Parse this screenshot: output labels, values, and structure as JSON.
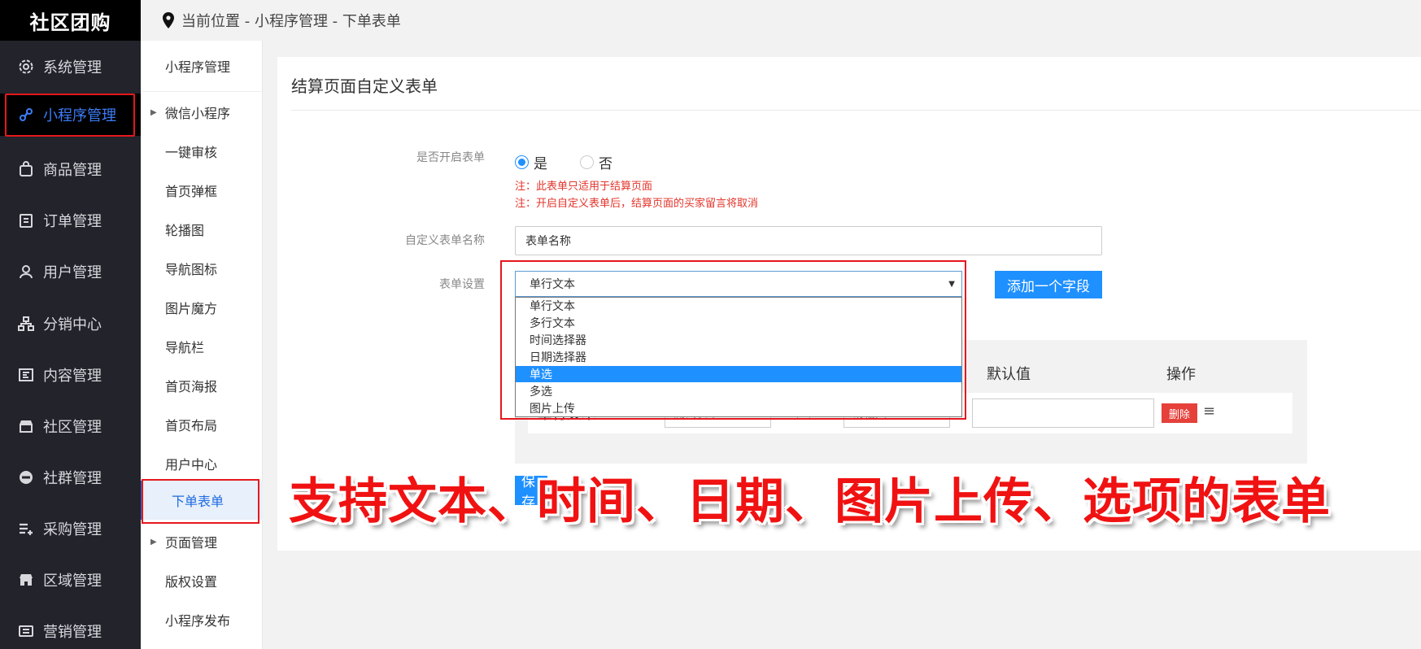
{
  "brand": "社区团购",
  "breadcrumb": "当前位置 - 小程序管理 - 下单表单",
  "sidebar": {
    "items": [
      {
        "label": "系统管理",
        "icon": "gear-icon"
      },
      {
        "label": "小程序管理",
        "icon": "link-icon"
      },
      {
        "label": "商品管理",
        "icon": "bag-icon"
      },
      {
        "label": "订单管理",
        "icon": "clipboard-icon"
      },
      {
        "label": "用户管理",
        "icon": "user-icon"
      },
      {
        "label": "分销中心",
        "icon": "hierarchy-icon"
      },
      {
        "label": "内容管理",
        "icon": "article-icon"
      },
      {
        "label": "社区管理",
        "icon": "store-icon"
      },
      {
        "label": "社群管理",
        "icon": "minus-circle-icon"
      },
      {
        "label": "采购管理",
        "icon": "list-add-icon"
      },
      {
        "label": "区域管理",
        "icon": "shop-icon"
      },
      {
        "label": "营销管理",
        "icon": "ticket-icon"
      }
    ]
  },
  "subnav": {
    "header": "小程序管理",
    "items": [
      "微信小程序",
      "一键审核",
      "首页弹框",
      "轮播图",
      "导航图标",
      "图片魔方",
      "导航栏",
      "首页海报",
      "首页布局",
      "用户中心",
      "下单表单",
      "页面管理",
      "版权设置",
      "小程序发布"
    ]
  },
  "panel": {
    "title": "结算页面自定义表单",
    "enable_label": "是否开启表单",
    "yes": "是",
    "no": "否",
    "note1": "注：此表单只适用于结算页面",
    "note2": "注：开启自定义表单后，结算页面的买家留言将取消",
    "name_label": "自定义表单名称",
    "name_value": "表单名称",
    "settings_label": "表单设置",
    "select_value": "单行文本",
    "options": [
      "单行文本",
      "多行文本",
      "时间选择器",
      "日期选择器",
      "单选",
      "多选",
      "图片上传"
    ],
    "selected_option": "单选",
    "add_button": "添加一个字段",
    "col_default": "默认值",
    "col_action": "操作",
    "row_type": "单行文本",
    "row_input1": "测试表单",
    "row_input2": "请输入",
    "delete": "删除",
    "save": "保存"
  },
  "overlay": "支持文本、时间、日期、图片上传、选项的表单",
  "colors": {
    "accent": "#1e90ff",
    "annotation": "#e5171d",
    "sidebar_bg": "#22232b"
  }
}
